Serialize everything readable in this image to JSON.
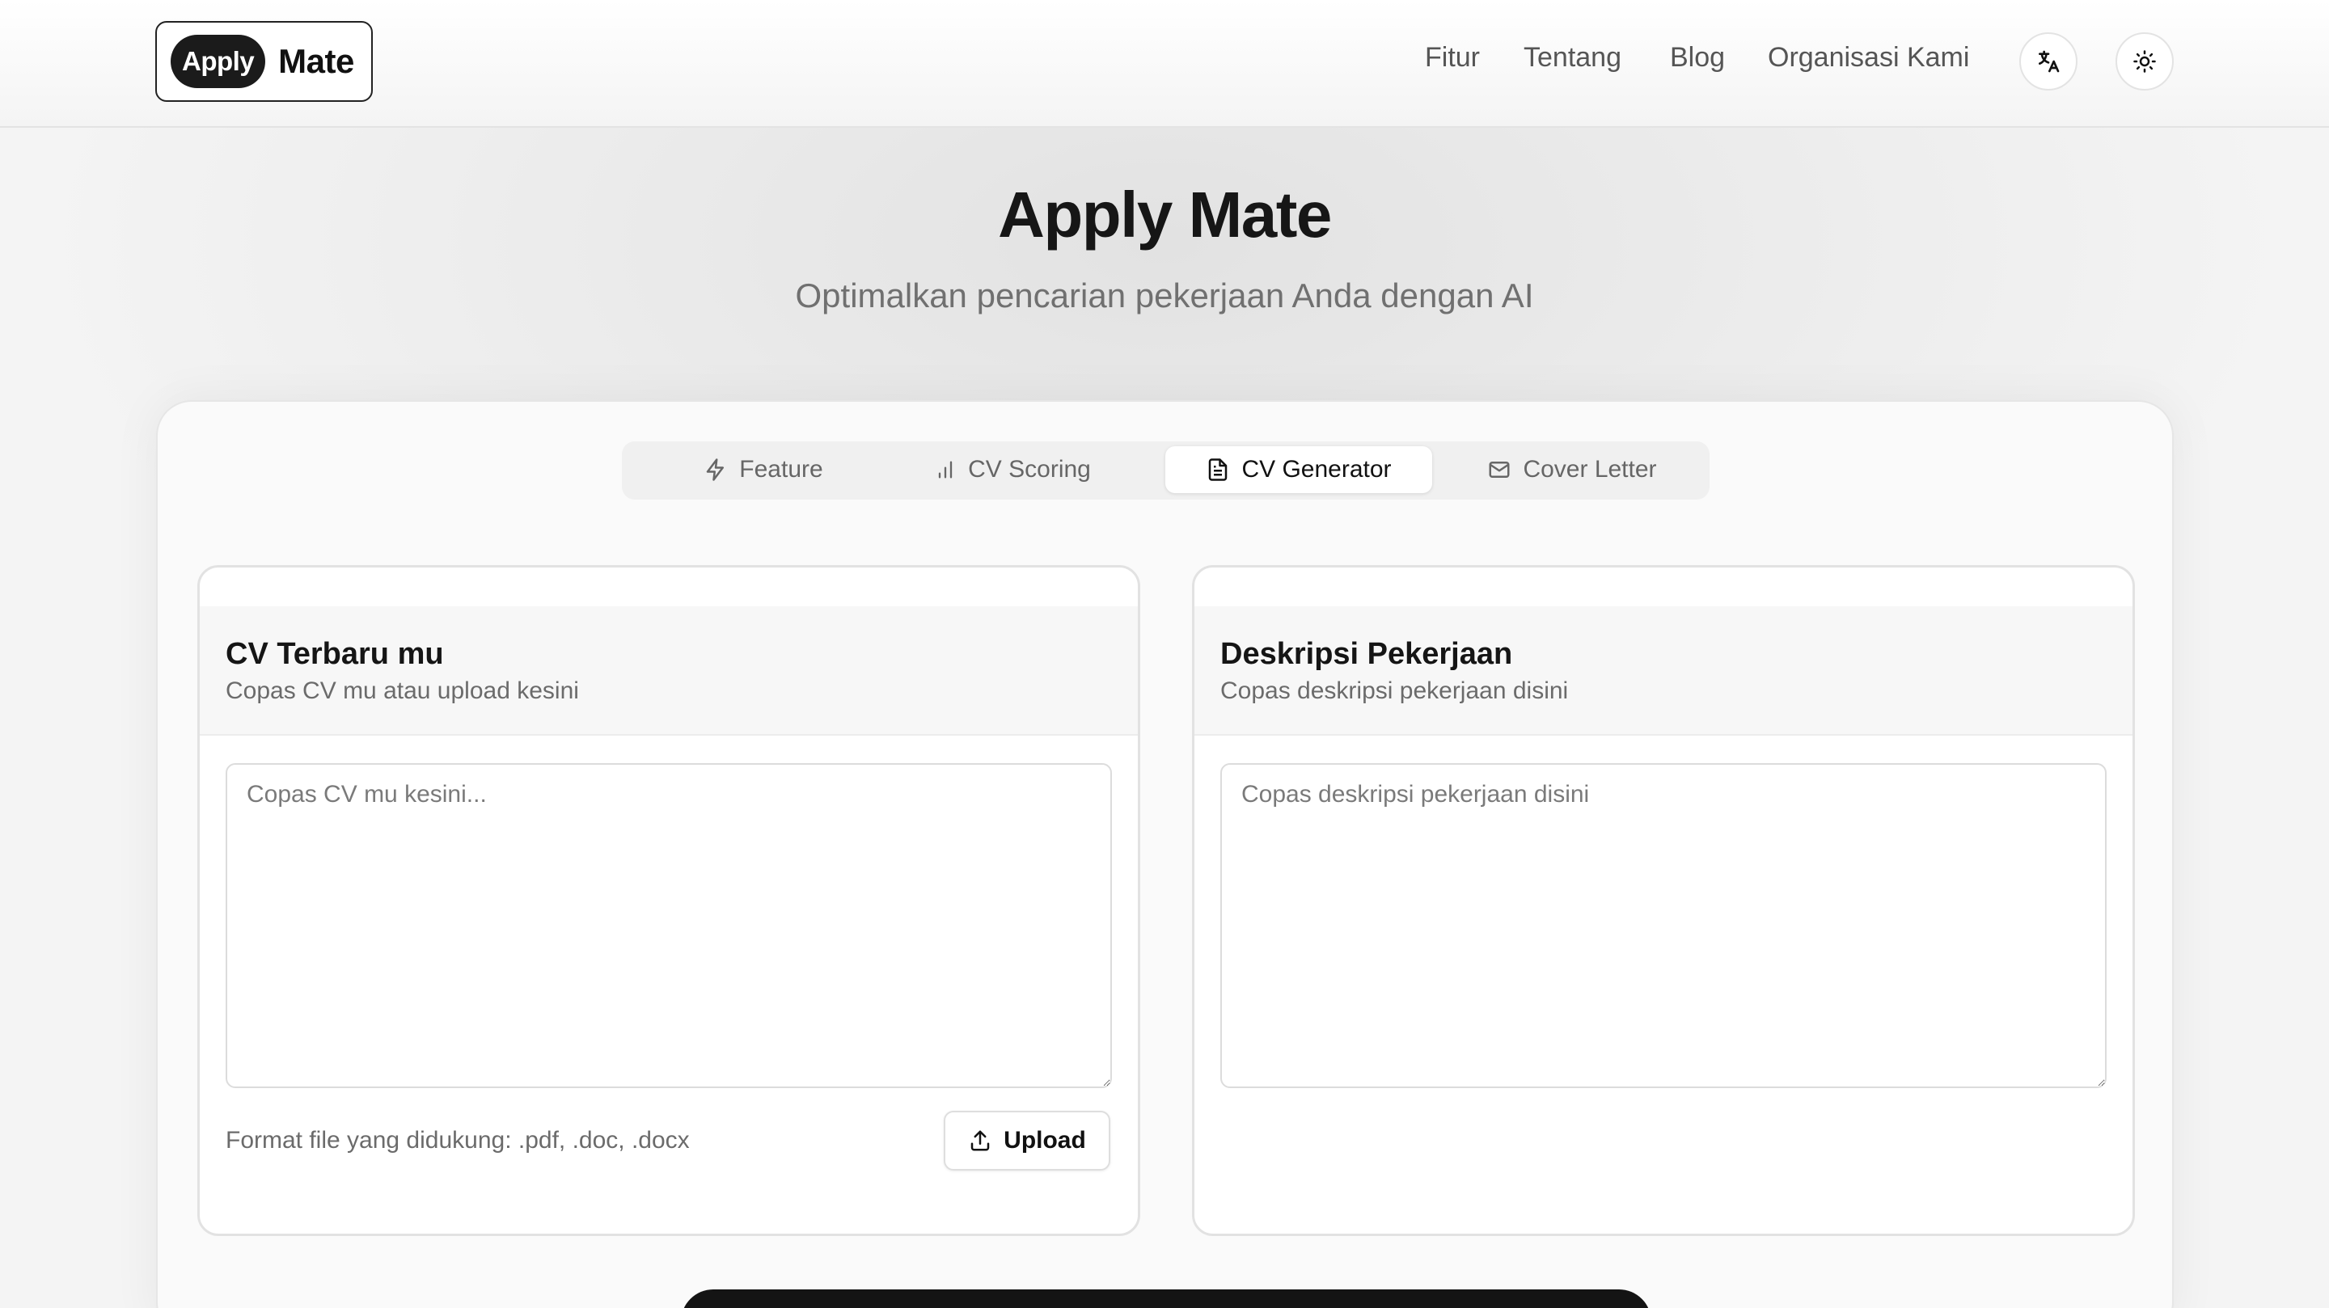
{
  "header": {
    "logo_pill": "Apply",
    "logo_word": "Mate",
    "nav": [
      "Fitur",
      "Tentang",
      "Blog",
      "Organisasi Kami"
    ],
    "icons": [
      "translate-icon",
      "sun-icon"
    ]
  },
  "hero": {
    "title": "Apply Mate",
    "subtitle": "Optimalkan pencarian pekerjaan Anda dengan AI"
  },
  "tabs": [
    {
      "label": "Feature",
      "icon": "lightning-icon",
      "active": false
    },
    {
      "label": "CV Scoring",
      "icon": "bar-chart-icon",
      "active": false
    },
    {
      "label": "CV Generator",
      "icon": "document-icon",
      "active": true
    },
    {
      "label": "Cover Letter",
      "icon": "mail-icon",
      "active": false
    }
  ],
  "cv_panel": {
    "title": "CV Terbaru mu",
    "description": "Copas CV mu atau upload kesini",
    "placeholder": "Copas CV mu kesini...",
    "value": "",
    "format_note": "Format file yang didukung: .pdf, .doc, .docx",
    "upload_label": "Upload"
  },
  "job_panel": {
    "title": "Deskripsi Pekerjaan",
    "description": "Copas deskripsi pekerjaan disini",
    "placeholder": "Copas deskripsi pekerjaan disini",
    "value": ""
  },
  "colors": {
    "accent_dark": "#141414",
    "muted_text": "#6b6b6b",
    "background": "#efefef"
  }
}
